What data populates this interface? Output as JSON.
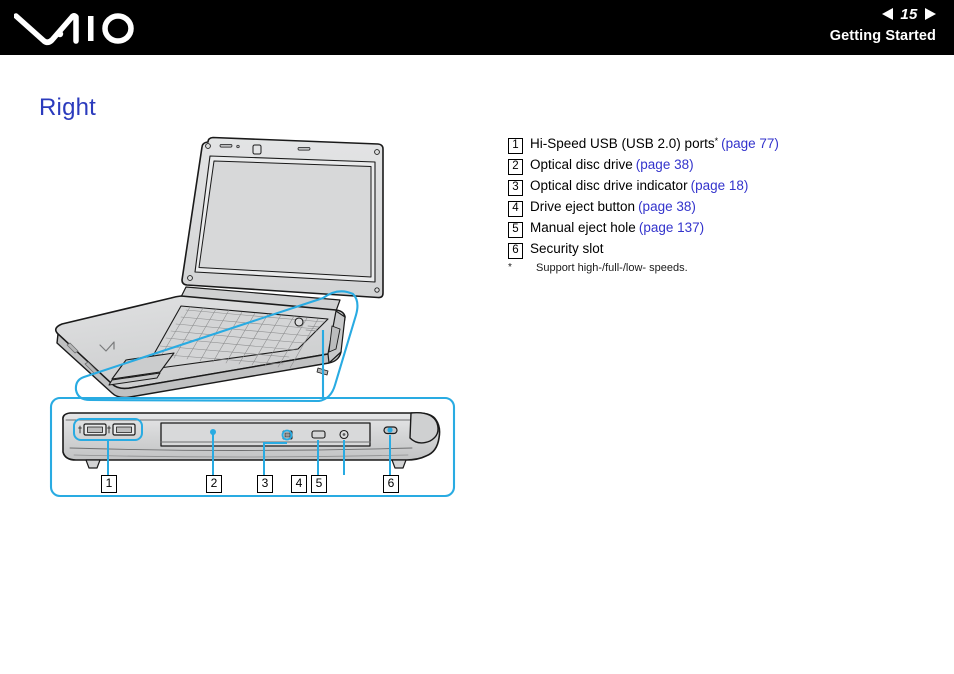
{
  "header": {
    "logo_name": "VAIO",
    "page_number": "15",
    "prev_icon": "left-arrow-icon",
    "next_icon": "right-arrow-icon",
    "section": "Getting Started"
  },
  "page": {
    "title": "Right"
  },
  "callouts": [
    {
      "num": "1",
      "text": "Hi-Speed USB (USB 2.0) ports",
      "superscript": "*",
      "page_ref": "(page 77)"
    },
    {
      "num": "2",
      "text": "Optical disc drive",
      "superscript": "",
      "page_ref": "(page 38)"
    },
    {
      "num": "3",
      "text": "Optical disc drive indicator",
      "superscript": "",
      "page_ref": "(page 18)"
    },
    {
      "num": "4",
      "text": "Drive eject button",
      "superscript": "",
      "page_ref": "(page 38)"
    },
    {
      "num": "5",
      "text": "Manual eject hole",
      "superscript": "",
      "page_ref": "(page 137)"
    },
    {
      "num": "6",
      "text": "Security slot",
      "superscript": "",
      "page_ref": ""
    }
  ],
  "footnote": {
    "mark": "*",
    "text": "Support high-/full-/low- speeds."
  },
  "detail_panel": {
    "numbers": [
      "1",
      "2",
      "3",
      "4",
      "5",
      "6"
    ]
  },
  "colors": {
    "header_bg": "#000000",
    "title_blue": "#2b3bbd",
    "link_blue": "#3333cc",
    "highlight_cyan": "#29abe2",
    "illustration_line": "#1a1a1a",
    "illustration_fill": "#d9dadb"
  }
}
